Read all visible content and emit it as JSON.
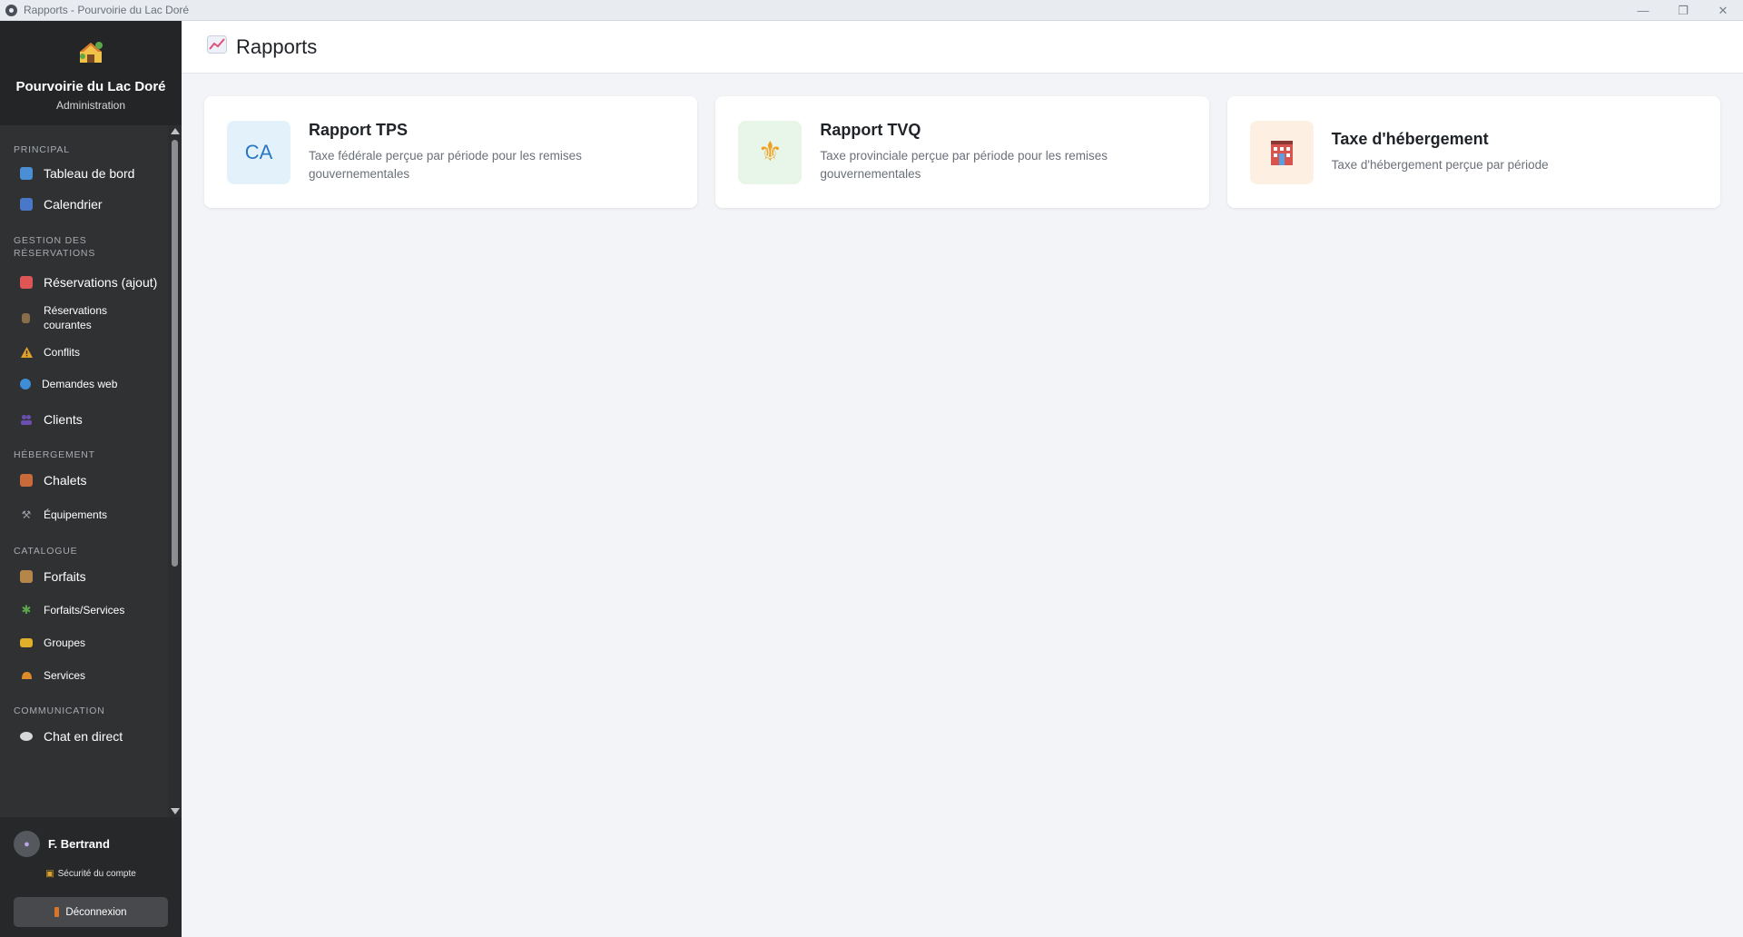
{
  "window": {
    "title": "Rapports - Pourvoirie du Lac Doré"
  },
  "brand": {
    "name": "Pourvoirie du Lac Doré",
    "subtitle": "Administration"
  },
  "nav": {
    "sections": [
      {
        "label": "PRINCIPAL",
        "items": [
          {
            "label": "Tableau de bord",
            "icon": "bar-chart-icon",
            "color": "#4a8fd6"
          },
          {
            "label": "Calendrier",
            "icon": "calendar-icon",
            "color": "#4a78c9"
          }
        ]
      },
      {
        "label": "GESTION DES RÉSERVATIONS",
        "items": [
          {
            "label": "Réservations (ajout)",
            "icon": "clipboard-icon",
            "color": "#d55"
          },
          {
            "label": "Réservations courantes",
            "icon": "notepad-icon",
            "color": "#8a6d4a"
          },
          {
            "label": "Conflits",
            "icon": "warning-icon",
            "color": "#e0a12a"
          },
          {
            "label": "Demandes web",
            "icon": "globe-icon",
            "color": "#3d8ed6"
          },
          {
            "label": "Clients",
            "icon": "users-icon",
            "color": "#6b4fb0"
          }
        ]
      },
      {
        "label": "HÉBERGEMENT",
        "items": [
          {
            "label": "Chalets",
            "icon": "house-icon",
            "color": "#c86a3a"
          },
          {
            "label": "Équipements",
            "icon": "wrench-icon",
            "color": "#9a9ea4"
          }
        ]
      },
      {
        "label": "CATALOGUE",
        "items": [
          {
            "label": "Forfaits",
            "icon": "package-icon",
            "color": "#b4864a"
          },
          {
            "label": "Forfaits/Services",
            "icon": "puzzle-icon",
            "color": "#5aa84a"
          },
          {
            "label": "Groupes",
            "icon": "folder-icon",
            "color": "#e0b02a"
          },
          {
            "label": "Services",
            "icon": "bell-icon",
            "color": "#e08a2a"
          }
        ]
      },
      {
        "label": "COMMUNICATION",
        "items": [
          {
            "label": "Chat en direct",
            "icon": "speech-bubble-icon",
            "color": "#d8d8d8"
          }
        ]
      }
    ]
  },
  "user": {
    "name": "F. Bertrand",
    "security_label": "Sécurité du compte",
    "logout_label": "Déconnexion"
  },
  "header": {
    "title": "Rapports",
    "icon": "chart-increasing-icon"
  },
  "cards": [
    {
      "title": "Rapport TPS",
      "description": "Taxe fédérale perçue par période pour les remises gouvernementales",
      "icon_text": "CA",
      "icon": "canada-flag-icon",
      "icon_bg": "#e3f1fb",
      "icon_color": "#2b78c2"
    },
    {
      "title": "Rapport TVQ",
      "description": "Taxe provinciale perçue par période pour les remises gouvernementales",
      "icon": "fleur-de-lis-icon",
      "icon_bg": "#e8f5e9",
      "icon_color": "#f0a020"
    },
    {
      "title": "Taxe d'hébergement",
      "description": "Taxe d'hébergement perçue par période",
      "icon": "hotel-icon",
      "icon_bg": "#fdf0e2",
      "icon_color": "#d9534f"
    }
  ]
}
